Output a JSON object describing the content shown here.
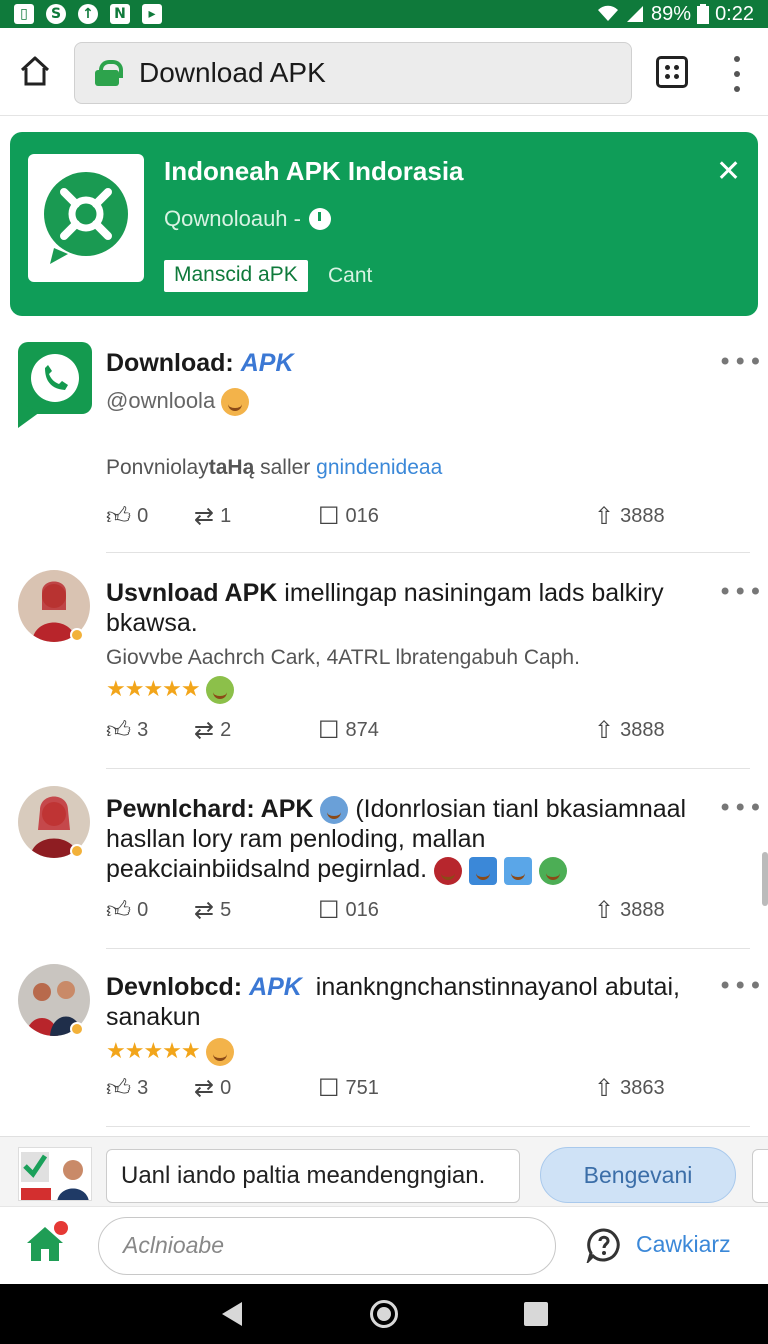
{
  "status_bar": {
    "left_icons": [
      "app-icon",
      "shazam-icon",
      "upload-icon",
      "netflix-icon",
      "play-icon"
    ],
    "battery": "89%",
    "time": "0:22"
  },
  "browser": {
    "url": "Download APK"
  },
  "banner": {
    "title": "Indoneah APK Indorasia",
    "subtitle": "Qownoloauh -",
    "button_label": "Manscid aPK",
    "cancel_label": "Cant",
    "color": "#0f9d58"
  },
  "posts": [
    {
      "title_bold": "Download:",
      "title_blue": "APK",
      "title_rest": "",
      "handle": "@ownloola",
      "meta_text": "Ponvniolay",
      "meta_bold": "taHą",
      "meta_plain": "saller",
      "meta_link": "gnindenideaa",
      "actions": {
        "like": "0",
        "repost": "1",
        "comment": "016",
        "share": "3888"
      }
    },
    {
      "title_bold": "Usvnload APK",
      "title_rest": "imellingap nasiningam lads balkiry bkawsa.",
      "meta_text": "Giovvbe Aachrch Cark, 4ATRL lbratengabuh Caph.",
      "stars": "★★★★★",
      "actions": {
        "like": "3",
        "repost": "2",
        "comment": "874",
        "share": "3888"
      }
    },
    {
      "title_bold": "Pewnlchard: APK",
      "title_rest": "(Idonrlosian tianl bkasiamnaal hasllan lory ram penloding, mallan peakciainbiidsalnd pegirnlad.",
      "actions": {
        "like": "0",
        "repost": "5",
        "comment": "016",
        "share": "3888"
      }
    },
    {
      "title_bold": "Devnlobcd:",
      "title_blue": "APK",
      "title_rest": "inankngnchanstinnayanol abutai, sanakun",
      "stars": "★★★★★",
      "actions": {
        "like": "3",
        "repost": "0",
        "comment": "751",
        "share": "3863"
      }
    }
  ],
  "ad_bar": {
    "field_text": "Uanl iando paltia meandengngian.",
    "button_label": "Bengevani"
  },
  "bottom_nav": {
    "input_placeholder": "Aclnioabe",
    "chat_label": "Cawkiarz"
  }
}
